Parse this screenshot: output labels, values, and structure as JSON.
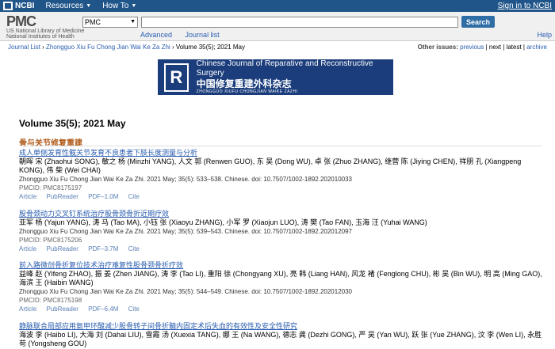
{
  "topbar": {
    "ncbi": "NCBI",
    "resources": "Resources",
    "howto": "How To",
    "signin": "Sign in to NCBI"
  },
  "header": {
    "logo": "PMC",
    "logo_sub": "US National Library of Medicine National Institutes of Health",
    "db_selected": "PMC",
    "search_button": "Search",
    "advanced": "Advanced",
    "journal_list": "Journal list",
    "help": "Help"
  },
  "breadcrumb": {
    "items": [
      "Journal List",
      "Zhongguo Xiu Fu Chong Jian Wai Ke Za Zhi",
      "Volume 35(5); 2021 May"
    ],
    "other_label": "Other issues:",
    "other_links": [
      "previous",
      "next",
      "latest",
      "archive"
    ]
  },
  "banner": {
    "en": "Chinese Journal of Reparative and Reconstructive Surgery",
    "cn": "中国修复重建外科杂志",
    "pinyin": "ZHONGGUO XIUFU CHONGJIAN WAIKE ZAZHI"
  },
  "volume_title": "Volume 35(5); 2021 May",
  "section_title": "骨与关节修复重建",
  "articles": [
    {
      "title": "成人单侧发育性髋关节发育不良患者下肢长度测量与分析",
      "authors": "朝晖 宋 (Zhaohui SONG), 敏之 杨 (Minzhi YANG), 人文 郭 (Renwen GUO), 东 吴 (Dong WU), 卓 张 (Zhuo ZHANG), 继营 陈 (Jiying CHEN), 祥朋 孔 (Xiangpeng KONG), 伟 柴 (Wei CHAI)",
      "citation": "Zhongguo Xiu Fu Chong Jian Wai Ke Za Zhi. 2021 May; 35(5): 533–538. Chinese. doi: 10.7507/1002-1892.202010033",
      "pmcid": "PMCID: PMC8175197",
      "links": [
        "Article",
        "PubReader",
        "PDF–1.0M",
        "Cite"
      ]
    },
    {
      "title": "股骨颈动力交叉钉系统治疗股骨颈骨折近期疗效",
      "authors": "亚军 杨 (Yajun YANG), 涛 马 (Tao MA), 小钰 张 (Xiaoyu ZHANG), 小军 罗 (Xiaojun LUO), 涛 樊 (Tao FAN), 玉海 汪 (Yuhai WANG)",
      "citation": "Zhongguo Xiu Fu Chong Jian Wai Ke Za Zhi. 2021 May; 35(5): 539–543. Chinese. doi: 10.7507/1002-1892.202012097",
      "pmcid": "PMCID: PMC8175206",
      "links": [
        "Article",
        "PubReader",
        "PDF–3.7M",
        "Cite"
      ]
    },
    {
      "title": "前入路微创骨折复位技术治疗难复性股骨颈骨折疗效",
      "authors": "益峰 赵 (Yifeng ZHAO), 振 姜 (Zhen JIANG), 涛 李 (Tao LI), 重阳 徐 (Chongyang XU), 亮 韩 (Liang HAN), 风龙 褚 (Fenglong CHU), 彬 吴 (Bin WU), 明 高 (Ming GAO), 海滨 王 (Haibin WANG)",
      "citation": "Zhongguo Xiu Fu Chong Jian Wai Ke Za Zhi. 2021 May; 35(5): 544–549. Chinese. doi: 10.7507/1002-1892.202012030",
      "pmcid": "PMCID: PMC8175198",
      "links": [
        "Article",
        "PubReader",
        "PDF–6.4M",
        "Cite"
      ]
    },
    {
      "title": "静脉联合局部应用氨甲环酸减少股骨转子间骨折髓内固定术后失血的有效性及安全性研究",
      "authors": "海波 李 (Haibo LI), 大海 刘 (Dahai LIU), 雪霞 汤 (Xuexia TANG), 娜 王 (Na WANG), 德志 龚 (Dezhi GONG), 严 吴 (Yan WU), 跃 张 (Yue ZHANG), 汶 李 (Wen LI), 永胜 苟 (Yongsheng GOU)",
      "citation": "",
      "pmcid": "",
      "links": []
    }
  ]
}
